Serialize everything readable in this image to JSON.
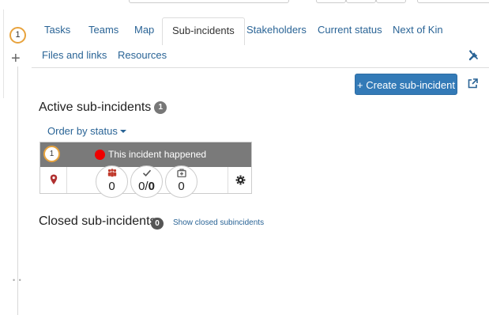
{
  "rail": {
    "step_number": "1"
  },
  "tabs_row1": [
    {
      "label": "Tasks"
    },
    {
      "label": "Teams"
    },
    {
      "label": "Map"
    },
    {
      "label": "Sub-incidents"
    },
    {
      "label": "Stakeholders"
    },
    {
      "label": "Current status"
    },
    {
      "label": "Next of Kin"
    }
  ],
  "tabs_row2": [
    {
      "label": "Files and links"
    },
    {
      "label": "Resources"
    }
  ],
  "active_tab": "Sub-incidents",
  "toolbar": {
    "create_label": "+ Create sub-incident"
  },
  "active_section": {
    "title": "Active sub-incidents",
    "count": "1",
    "order_label": "Order by status"
  },
  "card": {
    "number": "1",
    "title": "This incident happened",
    "status_color": "#ee0000",
    "metrics": {
      "people": "0",
      "tasks_done": "0",
      "tasks_total": "0",
      "resources": "0"
    }
  },
  "closed_section": {
    "title": "Closed sub-incidents",
    "count": "0",
    "show_label": "Show closed subincidents"
  },
  "colors": {
    "primary": "#337ab7",
    "link": "#2a6496",
    "header_gray": "#7a7a7a",
    "badge_orange": "#e8a33d"
  }
}
